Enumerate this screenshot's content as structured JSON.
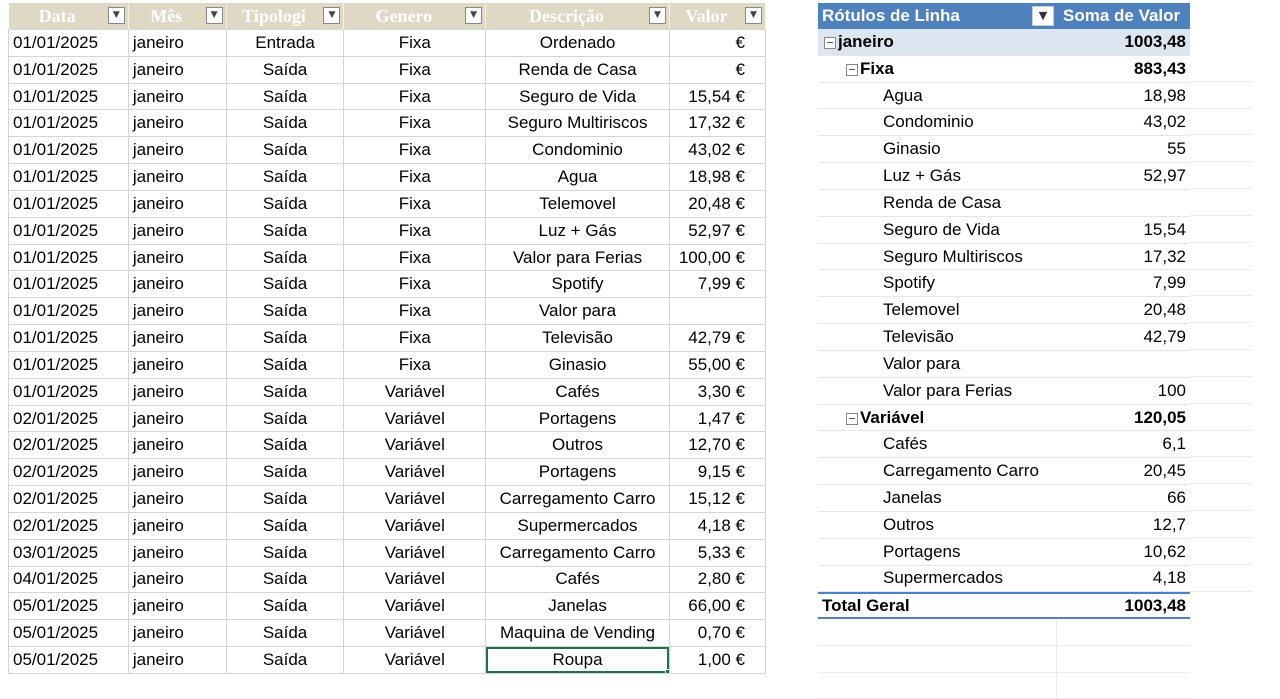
{
  "table": {
    "headers": [
      "Data",
      "Mês",
      "Tipologi",
      "Genero",
      "Descrição",
      "Valor"
    ],
    "rows": [
      [
        "01/01/2025",
        "janeiro",
        "Entrada",
        "Fixa",
        "Ordenado",
        "€"
      ],
      [
        "01/01/2025",
        "janeiro",
        "Saída",
        "Fixa",
        "Renda de Casa",
        "€"
      ],
      [
        "01/01/2025",
        "janeiro",
        "Saída",
        "Fixa",
        "Seguro de Vida",
        "15,54 €"
      ],
      [
        "01/01/2025",
        "janeiro",
        "Saída",
        "Fixa",
        "Seguro Multiriscos",
        "17,32 €"
      ],
      [
        "01/01/2025",
        "janeiro",
        "Saída",
        "Fixa",
        "Condominio",
        "43,02 €"
      ],
      [
        "01/01/2025",
        "janeiro",
        "Saída",
        "Fixa",
        "Agua",
        "18,98 €"
      ],
      [
        "01/01/2025",
        "janeiro",
        "Saída",
        "Fixa",
        "Telemovel",
        "20,48 €"
      ],
      [
        "01/01/2025",
        "janeiro",
        "Saída",
        "Fixa",
        "Luz + Gás",
        "52,97 €"
      ],
      [
        "01/01/2025",
        "janeiro",
        "Saída",
        "Fixa",
        "Valor para Ferias",
        "100,00 €"
      ],
      [
        "01/01/2025",
        "janeiro",
        "Saída",
        "Fixa",
        "Spotify",
        "7,99 €"
      ],
      [
        "01/01/2025",
        "janeiro",
        "Saída",
        "Fixa",
        "Valor para",
        ""
      ],
      [
        "01/01/2025",
        "janeiro",
        "Saída",
        "Fixa",
        "Televisão",
        "42,79 €"
      ],
      [
        "01/01/2025",
        "janeiro",
        "Saída",
        "Fixa",
        "Ginasio",
        "55,00 €"
      ],
      [
        "01/01/2025",
        "janeiro",
        "Saída",
        "Variável",
        "Cafés",
        "3,30 €"
      ],
      [
        "02/01/2025",
        "janeiro",
        "Saída",
        "Variável",
        "Portagens",
        "1,47 €"
      ],
      [
        "02/01/2025",
        "janeiro",
        "Saída",
        "Variável",
        "Outros",
        "12,70 €"
      ],
      [
        "02/01/2025",
        "janeiro",
        "Saída",
        "Variável",
        "Portagens",
        "9,15 €"
      ],
      [
        "02/01/2025",
        "janeiro",
        "Saída",
        "Variável",
        "Carregamento Carro",
        "15,12 €"
      ],
      [
        "02/01/2025",
        "janeiro",
        "Saída",
        "Variável",
        "Supermercados",
        "4,18 €"
      ],
      [
        "03/01/2025",
        "janeiro",
        "Saída",
        "Variável",
        "Carregamento Carro",
        "5,33 €"
      ],
      [
        "04/01/2025",
        "janeiro",
        "Saída",
        "Variável",
        "Cafés",
        "2,80 €"
      ],
      [
        "05/01/2025",
        "janeiro",
        "Saída",
        "Variável",
        "Janelas",
        "66,00 €"
      ],
      [
        "05/01/2025",
        "janeiro",
        "Saída",
        "Variável",
        "Maquina de Vending",
        "0,70 €"
      ],
      [
        "05/01/2025",
        "janeiro",
        "Saída",
        "Variável",
        "Roupa",
        "1,00 €"
      ]
    ]
  },
  "pivot": {
    "header_label": "Rótulos de Linha",
    "header_sum": "Soma de Valor",
    "rows": [
      {
        "level": 0,
        "expander": "−",
        "name": "janeiro",
        "value": "1003,48"
      },
      {
        "level": 1,
        "expander": "−",
        "name": "Fixa",
        "value": "883,43"
      },
      {
        "level": 2,
        "name": "Agua",
        "value": "18,98"
      },
      {
        "level": 2,
        "name": "Condominio",
        "value": "43,02"
      },
      {
        "level": 2,
        "name": "Ginasio",
        "value": "55"
      },
      {
        "level": 2,
        "name": "Luz + Gás",
        "value": "52,97"
      },
      {
        "level": 2,
        "name": "Renda de Casa",
        "value": ""
      },
      {
        "level": 2,
        "name": "Seguro de Vida",
        "value": "15,54"
      },
      {
        "level": 2,
        "name": "Seguro Multiriscos",
        "value": "17,32"
      },
      {
        "level": 2,
        "name": "Spotify",
        "value": "7,99"
      },
      {
        "level": 2,
        "name": "Telemovel",
        "value": "20,48"
      },
      {
        "level": 2,
        "name": "Televisão",
        "value": "42,79"
      },
      {
        "level": 2,
        "name": "Valor para",
        "value": ""
      },
      {
        "level": 2,
        "name": "Valor para Ferias",
        "value": "100"
      },
      {
        "level": 1,
        "expander": "−",
        "name": "Variável",
        "value": "120,05"
      },
      {
        "level": 2,
        "name": "Cafés",
        "value": "6,1"
      },
      {
        "level": 2,
        "name": "Carregamento Carro",
        "value": "20,45"
      },
      {
        "level": 2,
        "name": "Janelas",
        "value": "66"
      },
      {
        "level": 2,
        "name": "Outros",
        "value": "12,7"
      },
      {
        "level": 2,
        "name": "Portagens",
        "value": "10,62"
      },
      {
        "level": 2,
        "name": "Supermercados",
        "value": "4,18"
      }
    ],
    "total_label": "Total Geral",
    "total_value": "1003,48"
  },
  "icons": {
    "filter": "filter-dropdown-icon",
    "pivot_filter": "pivot-filter-icon",
    "cell_dropdown": "cell-dropdown-icon"
  },
  "colors": {
    "table_header_bg": "#ddd9c4",
    "pivot_header_bg": "#4f81bd",
    "pivot_group_bg": "#dce6f1",
    "selection": "#217346"
  }
}
